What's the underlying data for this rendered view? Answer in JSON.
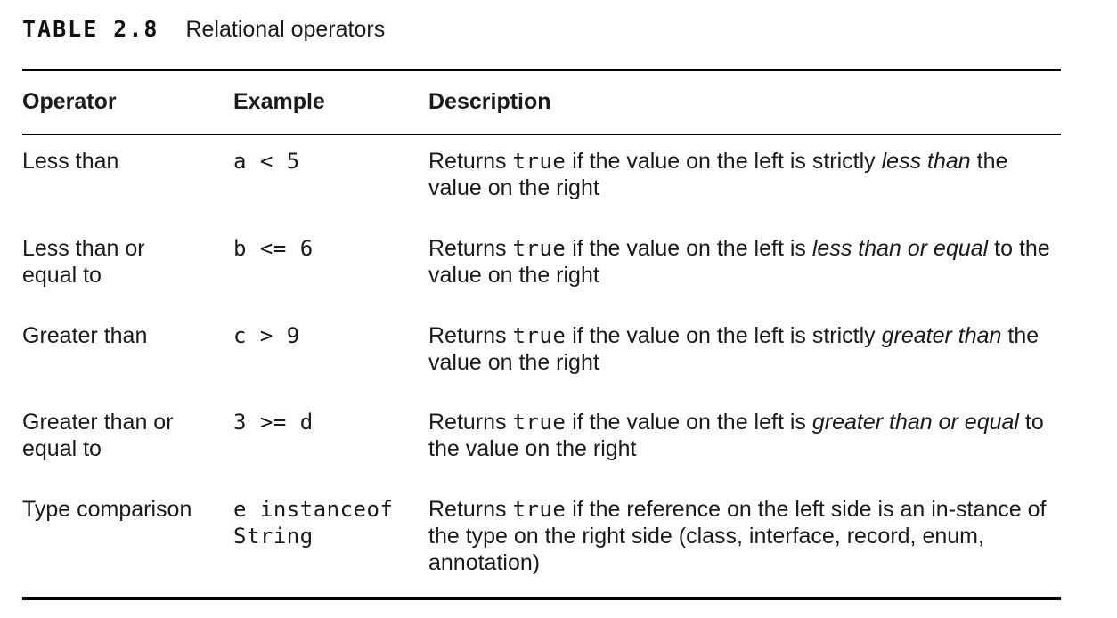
{
  "caption": {
    "label": "TABLE 2.8",
    "title": "Relational operators"
  },
  "columns": {
    "operator": "Operator",
    "example": "Example",
    "description": "Description"
  },
  "rows": [
    {
      "operator_l1": "Less than",
      "operator_l2": "",
      "example_l1": "a < 5",
      "example_l2": "",
      "desc_returns": "Returns",
      "desc_keyword": "true",
      "desc_pre": " if the value on the left is strictly ",
      "desc_em": "less than",
      "desc_post": " the value on the right"
    },
    {
      "operator_l1": "Less than or",
      "operator_l2": "equal to",
      "example_l1": "b <= 6",
      "example_l2": "",
      "desc_returns": "Returns",
      "desc_keyword": "true",
      "desc_pre": " if the value on the left is ",
      "desc_em": "less than or equal",
      "desc_post": " to the value on the right"
    },
    {
      "operator_l1": "Greater than",
      "operator_l2": "",
      "example_l1": "c > 9",
      "example_l2": "",
      "desc_returns": "Returns",
      "desc_keyword": "true",
      "desc_pre": " if the value on the left is strictly ",
      "desc_em": "greater than",
      "desc_post": " the value on the right"
    },
    {
      "operator_l1": "Greater than or",
      "operator_l2": "equal to",
      "example_l1": "3 >= d",
      "example_l2": "",
      "desc_returns": "Returns",
      "desc_keyword": "true",
      "desc_pre": " if the value on the left is ",
      "desc_em": "greater than or equal",
      "desc_post": " to the value on the right"
    },
    {
      "operator_l1": "Type comparison",
      "operator_l2": "",
      "example_l1": "e instanceof",
      "example_l2": "String",
      "desc_returns": "Returns",
      "desc_keyword": "true",
      "desc_pre": " if the reference on the left side is an in-stance of the type on the right side (class, interface, record, enum, annotation)",
      "desc_em": "",
      "desc_post": ""
    }
  ]
}
